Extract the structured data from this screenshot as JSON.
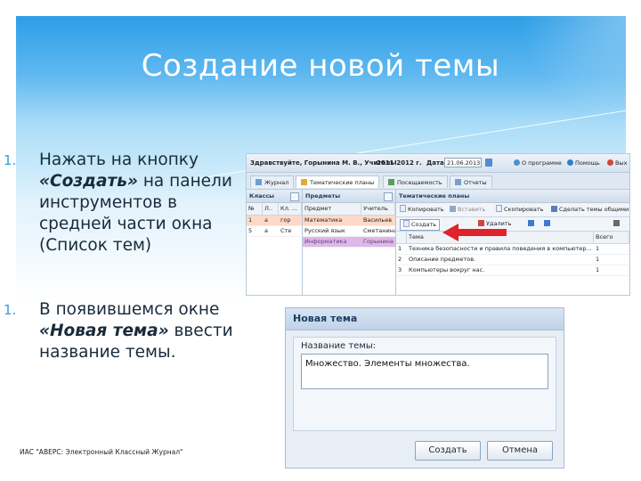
{
  "slide": {
    "title": "Создание новой темы",
    "bullets": [
      {
        "num": "1.",
        "pre": "Нажать на кнопку ",
        "quote": "«Создать»",
        "post": " на панели инструментов в средней части окна (Список тем)"
      },
      {
        "num": "1.",
        "pre": "В появившемся окне ",
        "quote": "«Новая тема»",
        "post": " ввести название темы."
      }
    ],
    "footer": "ИАС \"АВЕРС: Электронный Классный Журнал\""
  },
  "app": {
    "greeting": "Здравствуйте, Горынина М. В., Учитель!",
    "year": "2011-2012 г.",
    "date_label": "Дата:",
    "date_value": "21.06.2013",
    "about": "О программе",
    "help": "Помощь",
    "exit": "Вых",
    "tabs": [
      "Журнал",
      "Тематические планы",
      "Посещаемость",
      "Отчеты"
    ],
    "classes_panel": {
      "title": "Классы",
      "columns": [
        "№",
        "Л..",
        "Кл. ..."
      ],
      "rows": [
        [
          "1",
          "а",
          "гор"
        ],
        [
          "5",
          "а",
          "Сте"
        ]
      ]
    },
    "subjects_panel": {
      "title": "Предметы",
      "columns": [
        "Предмет",
        "Учитель"
      ],
      "rows": [
        [
          "Математика",
          "Васильев"
        ],
        [
          "Русский язык",
          "Сметанина"
        ],
        [
          "Информатика",
          "Горынина"
        ]
      ]
    },
    "themes_panel": {
      "title": "Тематические планы",
      "toolbar1": [
        "Копировать",
        "Вставить",
        "Скопировать",
        "Сделать темы общими"
      ],
      "toolbar2": [
        "Создать",
        "Удалить"
      ],
      "columns": [
        "",
        "Тема",
        "Всего"
      ],
      "rows": [
        [
          "1",
          "Техника безопасности и правила поведения в компьютер...",
          "1"
        ],
        [
          "2",
          "Описание предметов.",
          "1"
        ],
        [
          "3",
          "Компьютеры вокруг нас.",
          "1"
        ]
      ]
    }
  },
  "dialog": {
    "title": "Новая тема",
    "label": "Название темы:",
    "value": "Множество. Элементы множества.",
    "create": "Создать",
    "cancel": "Отмена"
  },
  "colors": {
    "header_blue": "#2e9ee6",
    "arrow_red": "#e0232b",
    "selected_row": "#ffd9c7",
    "highlight_row": "#dcb9e6"
  }
}
